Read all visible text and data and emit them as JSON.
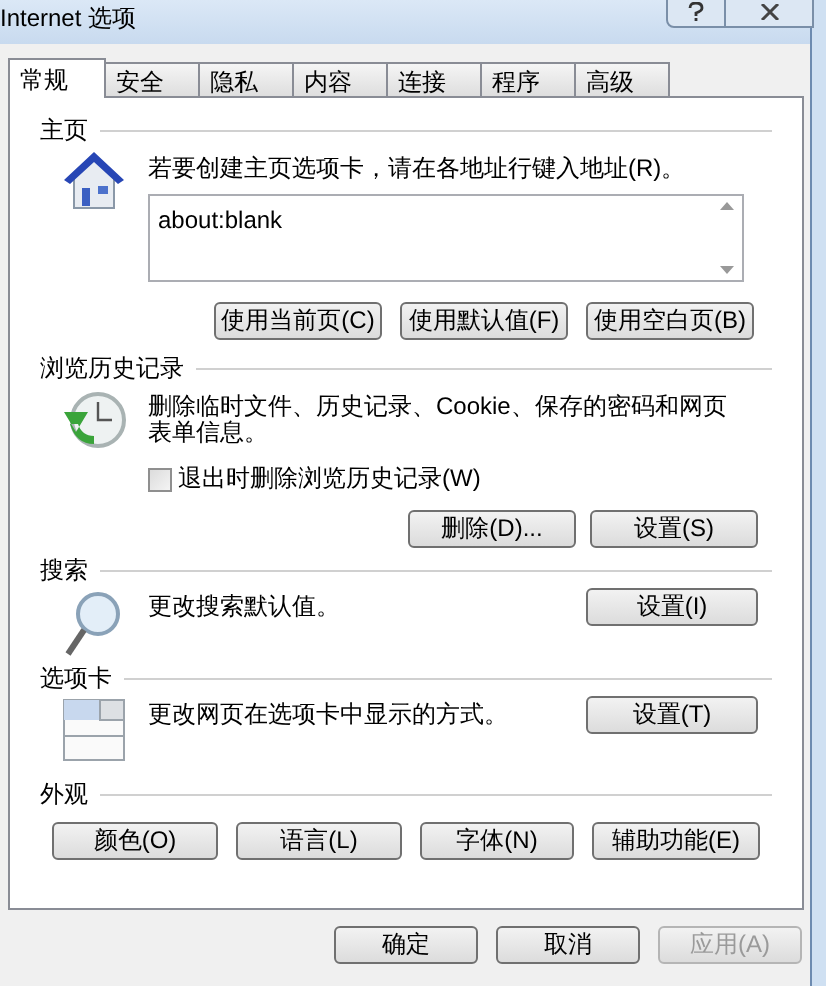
{
  "window": {
    "title": "Internet 选项"
  },
  "tabs": [
    {
      "label": "常规",
      "selected": true
    },
    {
      "label": "安全",
      "selected": false
    },
    {
      "label": "隐私",
      "selected": false
    },
    {
      "label": "内容",
      "selected": false
    },
    {
      "label": "连接",
      "selected": false
    },
    {
      "label": "程序",
      "selected": false
    },
    {
      "label": "高级",
      "selected": false
    }
  ],
  "sections": [
    {
      "kind": "home",
      "label": "主页",
      "text": "若要创建主页选项卡，请在各地址行键入地址(R)。",
      "value": "about:blank",
      "buttons": [
        "使用当前页(C)",
        "使用默认值(F)",
        "使用空白页(B)"
      ]
    },
    {
      "kind": "history",
      "label": "浏览历史记录",
      "text": "删除临时文件、历史记录、Cookie、保存的密码和网页表单信息。",
      "checkbox": {
        "label": "退出时删除浏览历史记录(W)",
        "checked": false
      },
      "buttons": [
        "删除(D)...",
        "设置(S)"
      ]
    },
    {
      "kind": "search",
      "label": "搜索",
      "text": "更改搜索默认值。",
      "buttons": [
        "设置(I)"
      ]
    },
    {
      "kind": "tabs",
      "label": "选项卡",
      "text": "更改网页在选项卡中显示的方式。",
      "buttons": [
        "设置(T)"
      ]
    },
    {
      "kind": "appearance",
      "label": "外观",
      "buttons": [
        "颜色(O)",
        "语言(L)",
        "字体(N)",
        "辅助功能(E)"
      ]
    }
  ],
  "footer_buttons": [
    {
      "label": "确定",
      "disabled": false
    },
    {
      "label": "取消",
      "disabled": false
    },
    {
      "label": "应用(A)",
      "disabled": true
    }
  ]
}
